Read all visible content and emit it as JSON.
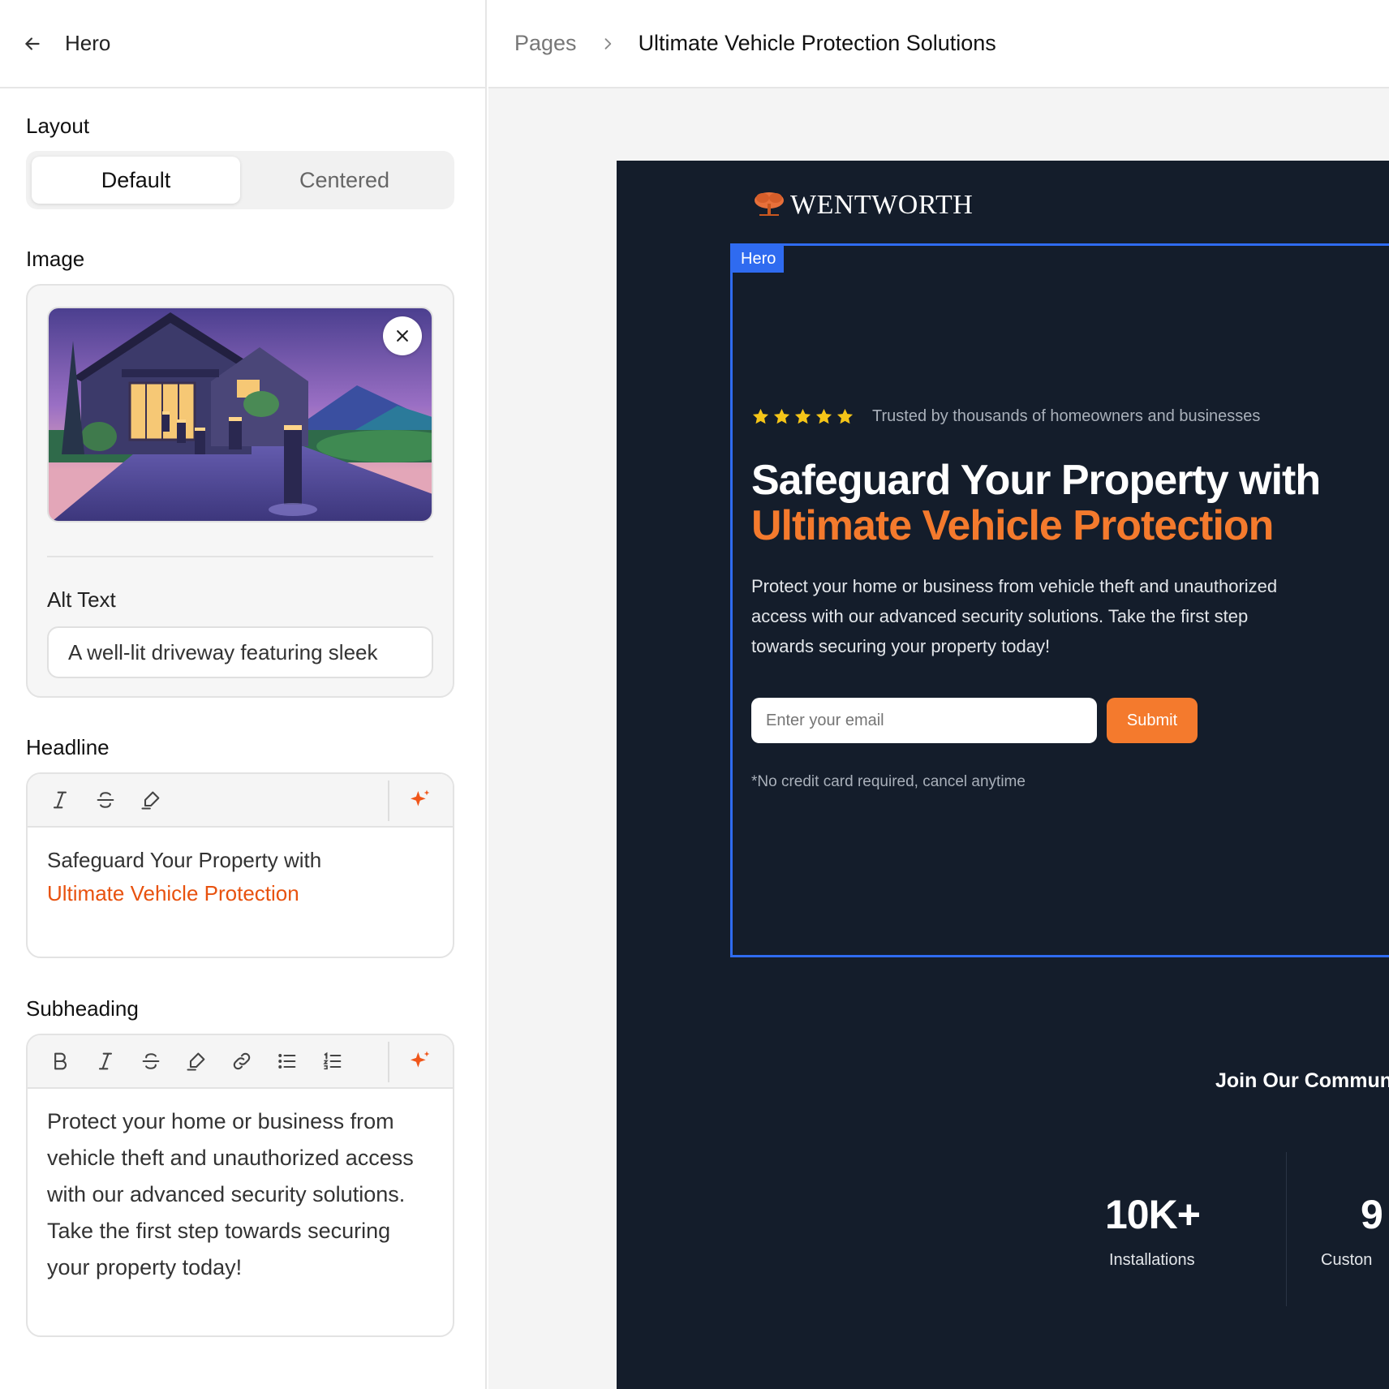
{
  "panel": {
    "title": "Hero",
    "layout": {
      "label": "Layout",
      "options": [
        "Default",
        "Centered"
      ],
      "selected": "Default"
    },
    "image": {
      "label": "Image",
      "alt_label": "Alt Text",
      "alt_value": "A well-lit driveway featuring sleek"
    },
    "headline": {
      "label": "Headline",
      "line1": "Safeguard Your Property with",
      "line2_highlight": "Ultimate Vehicle Protection"
    },
    "subheading": {
      "label": "Subheading",
      "text": "Protect your home or business from vehicle theft and unauthorized access with our advanced security solutions. Take the first step towards securing your property today!"
    }
  },
  "breadcrumb": {
    "root": "Pages",
    "current": "Ultimate Vehicle Protection Solutions"
  },
  "preview": {
    "logo_text": "WENTWORTH",
    "hero_tag": "Hero",
    "rating_stars": 5,
    "trust_text": "Trusted by thousands of homeowners and businesses",
    "headline_white": "Safeguard Your Property with",
    "headline_orange": "Ultimate Vehicle Protection",
    "subheading": "Protect your home or business from vehicle theft and unauthorized access with our advanced security solutions. Take the first step towards securing your property today!",
    "email_placeholder": "Enter your email",
    "submit_label": "Submit",
    "note": "*No credit card required, cancel anytime",
    "join_title": "Join Our Commun",
    "stats": [
      {
        "value": "10K+",
        "label": "Installations"
      },
      {
        "value": "9",
        "label": "Custon"
      }
    ]
  },
  "colors": {
    "accent": "#e8520f",
    "preview_bg": "#141d2b",
    "orange": "#f47a2d",
    "selection": "#2f6bf0",
    "star": "#f5c518"
  }
}
